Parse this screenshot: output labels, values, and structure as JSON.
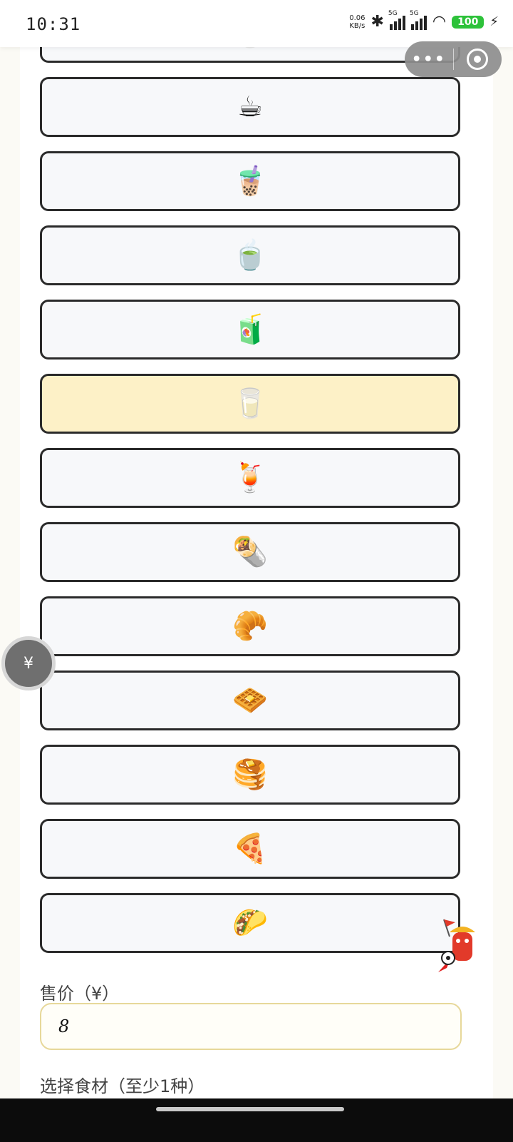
{
  "status_bar": {
    "time": "10:31",
    "net_speed_value": "0.06",
    "net_speed_unit": "KB/s",
    "signal_1_label": "5G",
    "signal_2_label": "5G",
    "battery": "100"
  },
  "icon_options": [
    {
      "emoji": "🥛",
      "selected": false,
      "icon": "milk-glass-icon"
    },
    {
      "emoji": "☕",
      "selected": false,
      "icon": "coffee-cup-icon"
    },
    {
      "emoji": "🧋",
      "selected": false,
      "icon": "bubble-tea-icon"
    },
    {
      "emoji": "🍵",
      "selected": false,
      "icon": "matcha-tea-icon"
    },
    {
      "emoji": "🧃",
      "selected": false,
      "icon": "juice-box-icon"
    },
    {
      "emoji": "🥛",
      "selected": true,
      "icon": "milk-glass-icon"
    },
    {
      "emoji": "🍹",
      "selected": false,
      "icon": "tropical-drink-icon"
    },
    {
      "emoji": "🌯",
      "selected": false,
      "icon": "burrito-icon"
    },
    {
      "emoji": "🥐",
      "selected": false,
      "icon": "croissant-icon"
    },
    {
      "emoji": "🧇",
      "selected": false,
      "icon": "waffle-icon"
    },
    {
      "emoji": "🥞",
      "selected": false,
      "icon": "pancakes-icon"
    },
    {
      "emoji": "🍕",
      "selected": false,
      "icon": "pizza-icon"
    },
    {
      "emoji": "🌮",
      "selected": false,
      "icon": "taco-icon"
    }
  ],
  "form": {
    "price_label": "售价（¥）",
    "price_value": "8",
    "ingredients_label": "选择食材（至少1种）"
  },
  "colors": {
    "selected_card_bg": "#fdf1c7",
    "card_bg": "#f7f8fa",
    "card_border": "#2a2a2a",
    "input_border": "#e7d89a"
  }
}
